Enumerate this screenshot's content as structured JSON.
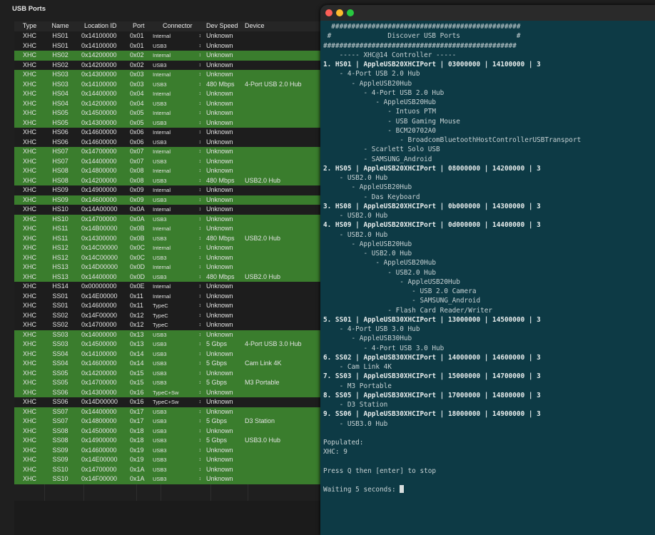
{
  "panel": {
    "title": "USB Ports"
  },
  "table": {
    "headers": [
      "Type",
      "Name",
      "Location ID",
      "Port",
      "Connector",
      "Dev Speed",
      "Device"
    ],
    "rows": [
      {
        "type": "XHC",
        "name": "HS01",
        "loc": "0x14100000",
        "port": "0x01",
        "conn": "Internal",
        "speed": "Unknown",
        "device": "",
        "hl": false
      },
      {
        "type": "XHC",
        "name": "HS01",
        "loc": "0x14100000",
        "port": "0x01",
        "conn": "USB3",
        "speed": "Unknown",
        "device": "",
        "hl": false
      },
      {
        "type": "XHC",
        "name": "HS02",
        "loc": "0x14200000",
        "port": "0x02",
        "conn": "Internal",
        "speed": "Unknown",
        "device": "",
        "hl": true
      },
      {
        "type": "XHC",
        "name": "HS02",
        "loc": "0x14200000",
        "port": "0x02",
        "conn": "USB3",
        "speed": "Unknown",
        "device": "",
        "hl": false
      },
      {
        "type": "XHC",
        "name": "HS03",
        "loc": "0x14300000",
        "port": "0x03",
        "conn": "Internal",
        "speed": "Unknown",
        "device": "",
        "hl": true
      },
      {
        "type": "XHC",
        "name": "HS03",
        "loc": "0x14100000",
        "port": "0x03",
        "conn": "USB3",
        "speed": "480 Mbps",
        "device": "4-Port USB 2.0 Hub",
        "hl": true
      },
      {
        "type": "XHC",
        "name": "HS04",
        "loc": "0x14400000",
        "port": "0x04",
        "conn": "Internal",
        "speed": "Unknown",
        "device": "",
        "hl": true
      },
      {
        "type": "XHC",
        "name": "HS04",
        "loc": "0x14200000",
        "port": "0x04",
        "conn": "USB3",
        "speed": "Unknown",
        "device": "",
        "hl": true
      },
      {
        "type": "XHC",
        "name": "HS05",
        "loc": "0x14500000",
        "port": "0x05",
        "conn": "Internal",
        "speed": "Unknown",
        "device": "",
        "hl": true
      },
      {
        "type": "XHC",
        "name": "HS05",
        "loc": "0x14300000",
        "port": "0x05",
        "conn": "USB3",
        "speed": "Unknown",
        "device": "",
        "hl": true
      },
      {
        "type": "XHC",
        "name": "HS06",
        "loc": "0x14600000",
        "port": "0x06",
        "conn": "Internal",
        "speed": "Unknown",
        "device": "",
        "hl": false
      },
      {
        "type": "XHC",
        "name": "HS06",
        "loc": "0x14600000",
        "port": "0x06",
        "conn": "USB3",
        "speed": "Unknown",
        "device": "",
        "hl": false
      },
      {
        "type": "XHC",
        "name": "HS07",
        "loc": "0x14700000",
        "port": "0x07",
        "conn": "Internal",
        "speed": "Unknown",
        "device": "",
        "hl": true
      },
      {
        "type": "XHC",
        "name": "HS07",
        "loc": "0x14400000",
        "port": "0x07",
        "conn": "USB3",
        "speed": "Unknown",
        "device": "",
        "hl": true
      },
      {
        "type": "XHC",
        "name": "HS08",
        "loc": "0x14800000",
        "port": "0x08",
        "conn": "Internal",
        "speed": "Unknown",
        "device": "",
        "hl": true
      },
      {
        "type": "XHC",
        "name": "HS08",
        "loc": "0x14200000",
        "port": "0x08",
        "conn": "USB3",
        "speed": "480 Mbps",
        "device": "USB2.0 Hub",
        "hl": true
      },
      {
        "type": "XHC",
        "name": "HS09",
        "loc": "0x14900000",
        "port": "0x09",
        "conn": "Internal",
        "speed": "Unknown",
        "device": "",
        "hl": false
      },
      {
        "type": "XHC",
        "name": "HS09",
        "loc": "0x14600000",
        "port": "0x09",
        "conn": "USB3",
        "speed": "Unknown",
        "device": "",
        "hl": true
      },
      {
        "type": "XHC",
        "name": "HS10",
        "loc": "0x14A00000",
        "port": "0x0A",
        "conn": "Internal",
        "speed": "Unknown",
        "device": "",
        "hl": false
      },
      {
        "type": "XHC",
        "name": "HS10",
        "loc": "0x14700000",
        "port": "0x0A",
        "conn": "USB3",
        "speed": "Unknown",
        "device": "",
        "hl": true
      },
      {
        "type": "XHC",
        "name": "HS11",
        "loc": "0x14B00000",
        "port": "0x0B",
        "conn": "Internal",
        "speed": "Unknown",
        "device": "",
        "hl": true
      },
      {
        "type": "XHC",
        "name": "HS11",
        "loc": "0x14300000",
        "port": "0x0B",
        "conn": "USB3",
        "speed": "480 Mbps",
        "device": "USB2.0 Hub",
        "hl": true
      },
      {
        "type": "XHC",
        "name": "HS12",
        "loc": "0x14C00000",
        "port": "0x0C",
        "conn": "Internal",
        "speed": "Unknown",
        "device": "",
        "hl": true
      },
      {
        "type": "XHC",
        "name": "HS12",
        "loc": "0x14C00000",
        "port": "0x0C",
        "conn": "USB3",
        "speed": "Unknown",
        "device": "",
        "hl": true
      },
      {
        "type": "XHC",
        "name": "HS13",
        "loc": "0x14D00000",
        "port": "0x0D",
        "conn": "Internal",
        "speed": "Unknown",
        "device": "",
        "hl": true
      },
      {
        "type": "XHC",
        "name": "HS13",
        "loc": "0x14400000",
        "port": "0x0D",
        "conn": "USB3",
        "speed": "480 Mbps",
        "device": "USB2.0 Hub",
        "hl": true
      },
      {
        "type": "XHC",
        "name": "HS14",
        "loc": "0x00000000",
        "port": "0x0E",
        "conn": "Internal",
        "speed": "Unknown",
        "device": "",
        "hl": false
      },
      {
        "type": "XHC",
        "name": "SS01",
        "loc": "0x14E00000",
        "port": "0x11",
        "conn": "Internal",
        "speed": "Unknown",
        "device": "",
        "hl": false
      },
      {
        "type": "XHC",
        "name": "SS01",
        "loc": "0x14600000",
        "port": "0x11",
        "conn": "TypeC",
        "speed": "Unknown",
        "device": "",
        "hl": false
      },
      {
        "type": "XHC",
        "name": "SS02",
        "loc": "0x14F00000",
        "port": "0x12",
        "conn": "TypeC",
        "speed": "Unknown",
        "device": "",
        "hl": false
      },
      {
        "type": "XHC",
        "name": "SS02",
        "loc": "0x14700000",
        "port": "0x12",
        "conn": "TypeC",
        "speed": "Unknown",
        "device": "",
        "hl": false
      },
      {
        "type": "XHC",
        "name": "SS03",
        "loc": "0x14000000",
        "port": "0x13",
        "conn": "USB3",
        "speed": "Unknown",
        "device": "",
        "hl": true
      },
      {
        "type": "XHC",
        "name": "SS03",
        "loc": "0x14500000",
        "port": "0x13",
        "conn": "USB3",
        "speed": "5 Gbps",
        "device": "4-Port USB 3.0 Hub",
        "hl": true
      },
      {
        "type": "XHC",
        "name": "SS04",
        "loc": "0x14100000",
        "port": "0x14",
        "conn": "USB3",
        "speed": "Unknown",
        "device": "",
        "hl": true
      },
      {
        "type": "XHC",
        "name": "SS04",
        "loc": "0x14600000",
        "port": "0x14",
        "conn": "USB3",
        "speed": "5 Gbps",
        "device": "Cam Link 4K",
        "hl": true
      },
      {
        "type": "XHC",
        "name": "SS05",
        "loc": "0x14200000",
        "port": "0x15",
        "conn": "USB3",
        "speed": "Unknown",
        "device": "",
        "hl": true
      },
      {
        "type": "XHC",
        "name": "SS05",
        "loc": "0x14700000",
        "port": "0x15",
        "conn": "USB3",
        "speed": "5 Gbps",
        "device": "M3 Portable",
        "hl": true
      },
      {
        "type": "XHC",
        "name": "SS06",
        "loc": "0x14300000",
        "port": "0x16",
        "conn": "TypeC+Sw",
        "speed": "Unknown",
        "device": "",
        "hl": true
      },
      {
        "type": "XHC",
        "name": "SS06",
        "loc": "0x14D00000",
        "port": "0x16",
        "conn": "TypeC+Sw",
        "speed": "Unknown",
        "device": "",
        "hl": false
      },
      {
        "type": "XHC",
        "name": "SS07",
        "loc": "0x14400000",
        "port": "0x17",
        "conn": "USB3",
        "speed": "Unknown",
        "device": "",
        "hl": true
      },
      {
        "type": "XHC",
        "name": "SS07",
        "loc": "0x14800000",
        "port": "0x17",
        "conn": "USB3",
        "speed": "5 Gbps",
        "device": "D3 Station",
        "hl": true
      },
      {
        "type": "XHC",
        "name": "SS08",
        "loc": "0x14500000",
        "port": "0x18",
        "conn": "USB3",
        "speed": "Unknown",
        "device": "",
        "hl": true
      },
      {
        "type": "XHC",
        "name": "SS08",
        "loc": "0x14900000",
        "port": "0x18",
        "conn": "USB3",
        "speed": "5 Gbps",
        "device": "USB3.0 Hub",
        "hl": true
      },
      {
        "type": "XHC",
        "name": "SS09",
        "loc": "0x14600000",
        "port": "0x19",
        "conn": "USB3",
        "speed": "Unknown",
        "device": "",
        "hl": true
      },
      {
        "type": "XHC",
        "name": "SS09",
        "loc": "0x14E00000",
        "port": "0x19",
        "conn": "USB3",
        "speed": "Unknown",
        "device": "",
        "hl": true
      },
      {
        "type": "XHC",
        "name": "SS10",
        "loc": "0x14700000",
        "port": "0x1A",
        "conn": "USB3",
        "speed": "Unknown",
        "device": "",
        "hl": true
      },
      {
        "type": "XHC",
        "name": "SS10",
        "loc": "0x14F00000",
        "port": "0x1A",
        "conn": "USB3",
        "speed": "Unknown",
        "device": "",
        "hl": true
      }
    ]
  },
  "terminal": {
    "lines": [
      {
        "t": "  ###############################################",
        "b": false
      },
      {
        "t": " #              Discover USB Ports              #",
        "b": false
      },
      {
        "t": "################################################",
        "b": false
      },
      {
        "t": "    ----- XHC@14 Controller -----",
        "b": false
      },
      {
        "t": "1. HS01 | AppleUSB20XHCIPort | 03000000 | 14100000 | 3",
        "b": true
      },
      {
        "t": "    - 4-Port USB 2.0 Hub",
        "b": false
      },
      {
        "t": "       - AppleUSB20Hub",
        "b": false
      },
      {
        "t": "          - 4-Port USB 2.0 Hub",
        "b": false
      },
      {
        "t": "             - AppleUSB20Hub",
        "b": false
      },
      {
        "t": "                - Intuos PTM",
        "b": false
      },
      {
        "t": "                - USB Gaming Mouse",
        "b": false
      },
      {
        "t": "                - BCM20702A0",
        "b": false
      },
      {
        "t": "                   - BroadcomBluetoothHostControllerUSBTransport",
        "b": false
      },
      {
        "t": "          - Scarlett Solo USB",
        "b": false
      },
      {
        "t": "          - SAMSUNG_Android",
        "b": false
      },
      {
        "t": "2. HS05 | AppleUSB20XHCIPort | 08000000 | 14200000 | 3",
        "b": true
      },
      {
        "t": "    - USB2.0 Hub",
        "b": false
      },
      {
        "t": "       - AppleUSB20Hub",
        "b": false
      },
      {
        "t": "          - Das Keyboard",
        "b": false
      },
      {
        "t": "3. HS08 | AppleUSB20XHCIPort | 0b000000 | 14300000 | 3",
        "b": true
      },
      {
        "t": "    - USB2.0 Hub",
        "b": false
      },
      {
        "t": "4. HS09 | AppleUSB20XHCIPort | 0d000000 | 14400000 | 3",
        "b": true
      },
      {
        "t": "    - USB2.0 Hub",
        "b": false
      },
      {
        "t": "       - AppleUSB20Hub",
        "b": false
      },
      {
        "t": "          - USB2.0 Hub",
        "b": false
      },
      {
        "t": "             - AppleUSB20Hub",
        "b": false
      },
      {
        "t": "                - USB2.0 Hub",
        "b": false
      },
      {
        "t": "                   - AppleUSB20Hub",
        "b": false
      },
      {
        "t": "                      - USB 2.0 Camera",
        "b": false
      },
      {
        "t": "                      - SAMSUNG_Android",
        "b": false
      },
      {
        "t": "                - Flash Card Reader/Writer",
        "b": false
      },
      {
        "t": "5. SS01 | AppleUSB30XHCIPort | 13000000 | 14500000 | 3",
        "b": true
      },
      {
        "t": "    - 4-Port USB 3.0 Hub",
        "b": false
      },
      {
        "t": "       - AppleUSB30Hub",
        "b": false
      },
      {
        "t": "          - 4-Port USB 3.0 Hub",
        "b": false
      },
      {
        "t": "6. SS02 | AppleUSB30XHCIPort | 14000000 | 14600000 | 3",
        "b": true
      },
      {
        "t": "    - Cam Link 4K",
        "b": false
      },
      {
        "t": "7. SS03 | AppleUSB30XHCIPort | 15000000 | 14700000 | 3",
        "b": true
      },
      {
        "t": "    - M3 Portable",
        "b": false
      },
      {
        "t": "8. SS05 | AppleUSB30XHCIPort | 17000000 | 14800000 | 3",
        "b": true
      },
      {
        "t": "    - D3 Station",
        "b": false
      },
      {
        "t": "9. SS06 | AppleUSB30XHCIPort | 18000000 | 14900000 | 3",
        "b": true
      },
      {
        "t": "    - USB3.0 Hub",
        "b": false
      },
      {
        "t": "",
        "b": false
      },
      {
        "t": "Populated:",
        "b": false
      },
      {
        "t": "XHC: 9",
        "b": false
      },
      {
        "t": "",
        "b": false
      },
      {
        "t": "Press Q then [enter] to stop",
        "b": false
      },
      {
        "t": "",
        "b": false
      },
      {
        "t": "Waiting 5 seconds: ",
        "b": false,
        "cursor": true
      }
    ]
  }
}
